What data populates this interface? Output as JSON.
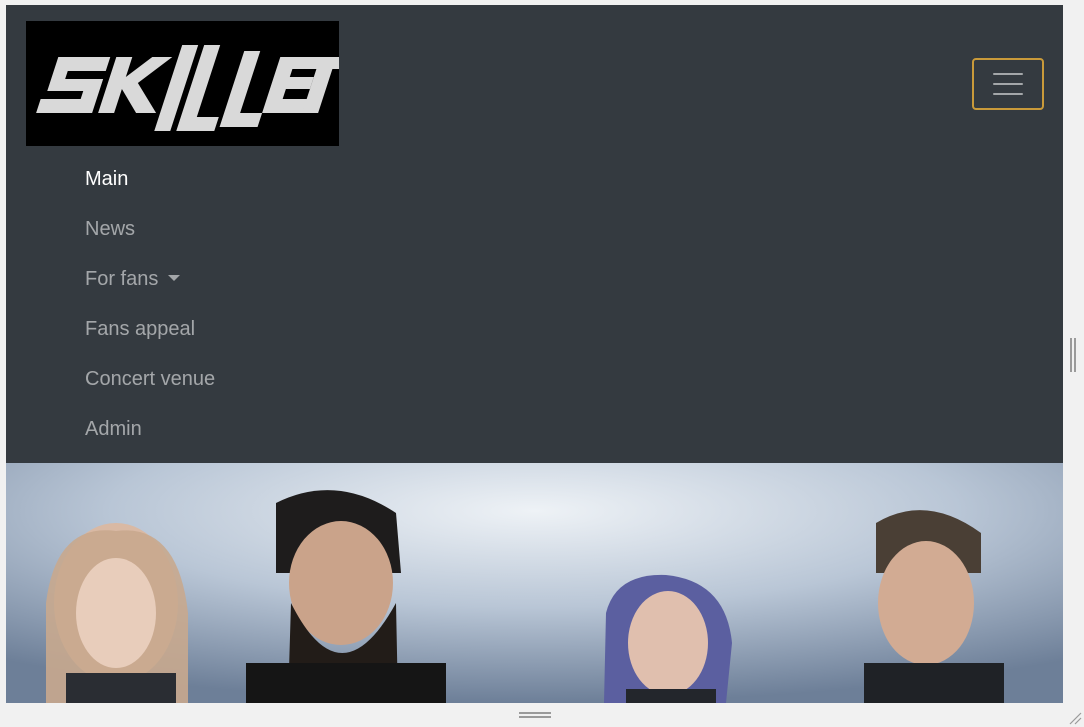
{
  "brand": {
    "logo_text": "SKILLET",
    "logo_icon": "skillet-logo"
  },
  "navbar": {
    "toggler_icon": "hamburger-menu-icon",
    "accent_color": "#c99a3a",
    "background_color": "#343a40",
    "items": [
      {
        "label": "Main",
        "active": true
      },
      {
        "label": "News",
        "active": false
      },
      {
        "label": "For fans",
        "active": false,
        "dropdown": true
      },
      {
        "label": "Fans appeal",
        "active": false
      },
      {
        "label": "Concert venue",
        "active": false
      },
      {
        "label": "Admin",
        "active": false
      }
    ]
  },
  "hero": {
    "image": "band-photo"
  }
}
